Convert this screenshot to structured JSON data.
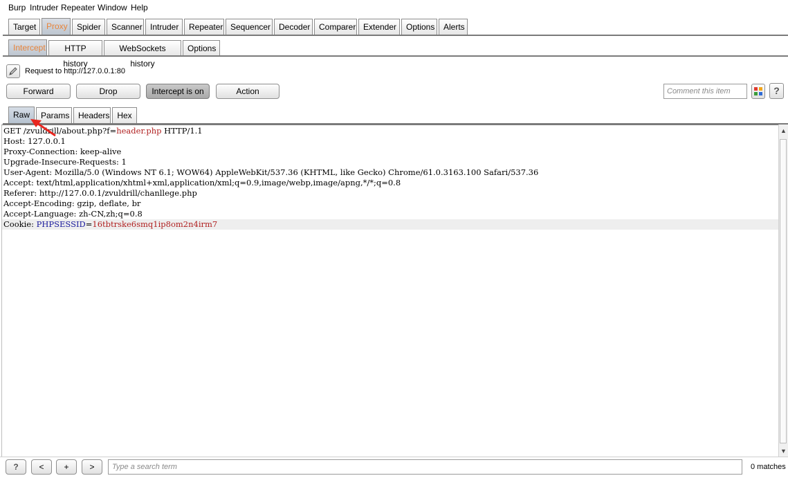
{
  "menu": [
    "Burp",
    "Intruder",
    "Repeater",
    "Window",
    "Help"
  ],
  "main_tabs": [
    "Target",
    "Proxy",
    "Spider",
    "Scanner",
    "Intruder",
    "Repeater",
    "Sequencer",
    "Decoder",
    "Comparer",
    "Extender",
    "Options",
    "Alerts"
  ],
  "active_main_tab": "Proxy",
  "sub_tabs": [
    "Intercept",
    "HTTP history",
    "WebSockets history",
    "Options"
  ],
  "active_sub_tab": "Intercept",
  "request_label": "Request to http://127.0.0.1:80",
  "actions": {
    "forward": "Forward",
    "drop": "Drop",
    "intercept": "Intercept is on",
    "action": "Action"
  },
  "comment_placeholder": "Comment this item",
  "help_label": "?",
  "view_tabs": [
    "Raw",
    "Params",
    "Headers",
    "Hex"
  ],
  "active_view_tab": "Raw",
  "request_lines": [
    {
      "parts": [
        {
          "t": "GET /zvuldrill/about.php?f=",
          "c": ""
        },
        {
          "t": "header.php",
          "c": "hl"
        },
        {
          "t": " HTTP/1.1",
          "c": ""
        }
      ]
    },
    {
      "parts": [
        {
          "t": "Host: 127.0.0.1",
          "c": ""
        }
      ]
    },
    {
      "parts": [
        {
          "t": "Proxy-Connection: keep-alive",
          "c": ""
        }
      ]
    },
    {
      "parts": [
        {
          "t": "Upgrade-Insecure-Requests: 1",
          "c": ""
        }
      ]
    },
    {
      "parts": [
        {
          "t": "User-Agent: Mozilla/5.0 (Windows NT 6.1; WOW64) AppleWebKit/537.36 (KHTML, like Gecko) Chrome/61.0.3163.100 Safari/537.36",
          "c": ""
        }
      ]
    },
    {
      "parts": [
        {
          "t": "Accept: text/html,application/xhtml+xml,application/xml;q=0.9,image/webp,image/apng,*/*;q=0.8",
          "c": ""
        }
      ]
    },
    {
      "parts": [
        {
          "t": "Referer: http://127.0.0.1/zvuldrill/chanllege.php",
          "c": ""
        }
      ]
    },
    {
      "parts": [
        {
          "t": "Accept-Encoding: gzip, deflate, br",
          "c": ""
        }
      ]
    },
    {
      "parts": [
        {
          "t": "Accept-Language: zh-CN,zh;q=0.8",
          "c": ""
        }
      ]
    },
    {
      "parts": [
        {
          "t": "Cookie: ",
          "c": ""
        },
        {
          "t": "PHPSESSID",
          "c": "key"
        },
        {
          "t": "=",
          "c": ""
        },
        {
          "t": "16tbtrske6smq1ip8om2n4irm7",
          "c": "hl"
        }
      ]
    }
  ],
  "search": {
    "help": "?",
    "prev": "<",
    "add": "+",
    "next": ">",
    "placeholder": "Type a search term",
    "matches": "0 matches"
  },
  "colors": {
    "active_tab_text": "#e8843a",
    "param_value": "#b02020",
    "cookie_name": "#1a1a9c",
    "arrow": "#e8261f"
  }
}
